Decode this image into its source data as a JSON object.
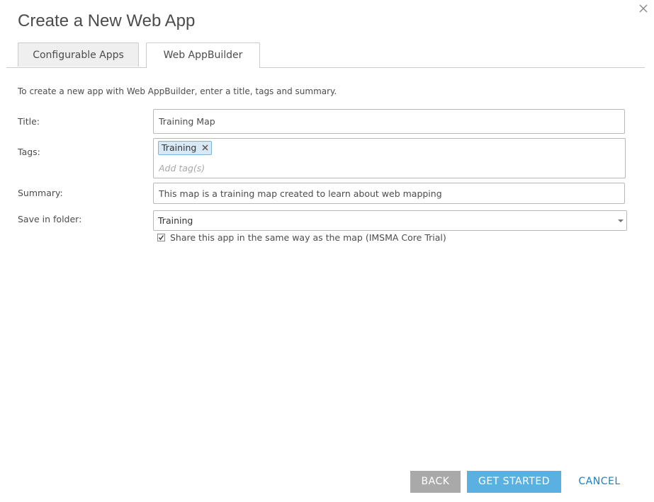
{
  "dialog": {
    "title": "Create a New Web App"
  },
  "tabs": [
    {
      "label": "Configurable Apps",
      "active": false
    },
    {
      "label": "Web AppBuilder",
      "active": true
    }
  ],
  "intro_text": "To create a new app with Web AppBuilder, enter a title, tags and summary.",
  "form": {
    "title_label": "Title:",
    "title_value": "Training Map",
    "tags_label": "Tags:",
    "tags": [
      "Training"
    ],
    "tags_placeholder": "Add tag(s)",
    "summary_label": "Summary:",
    "summary_value": "This map is a training map created to learn about web mapping",
    "folder_label": "Save in folder:",
    "folder_value": "Training",
    "share_checked": true,
    "share_label": "Share this app in the same way as the map (IMSMA Core Trial)"
  },
  "buttons": {
    "back": "BACK",
    "get_started": "GET STARTED",
    "cancel": "CANCEL"
  },
  "colors": {
    "primary_button": "#5ab0e0",
    "secondary_button": "#a9a9a9",
    "link_button": "#1f7fbf",
    "tag_chip": "#d8e9f5"
  },
  "icons": {
    "close": "close-icon",
    "tag_remove": "close-icon",
    "select_arrow": "chevron-down-icon",
    "checkbox_mark": "check-icon"
  }
}
